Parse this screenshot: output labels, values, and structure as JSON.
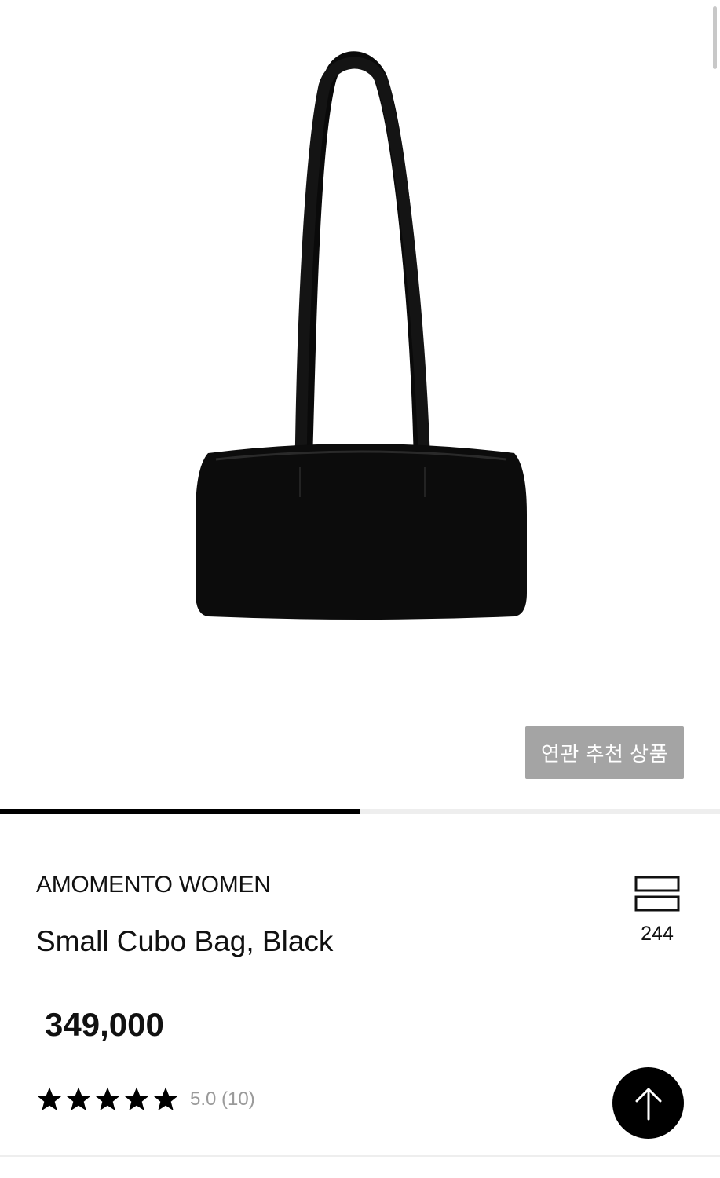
{
  "product": {
    "brand": "AMOMENTO WOMEN",
    "name": "Small Cubo Bag, Black",
    "price": "349,000",
    "image_icon": "black-shoulder-bag-image"
  },
  "related_button": {
    "label": "연관 추천 상품"
  },
  "gallery": {
    "progress": 0.5
  },
  "rating": {
    "stars": 5,
    "max_stars": 5,
    "text": "5.0 (10)"
  },
  "compare": {
    "icon": "stacked-boxes-icon",
    "count": "244"
  },
  "scroll_top": {
    "icon": "arrow-up-icon"
  },
  "colors": {
    "button_bg": "#a4a4a4",
    "progress_fill": "#000000",
    "progress_track": "#eeeeee",
    "rating_text": "#9a9a9a"
  }
}
